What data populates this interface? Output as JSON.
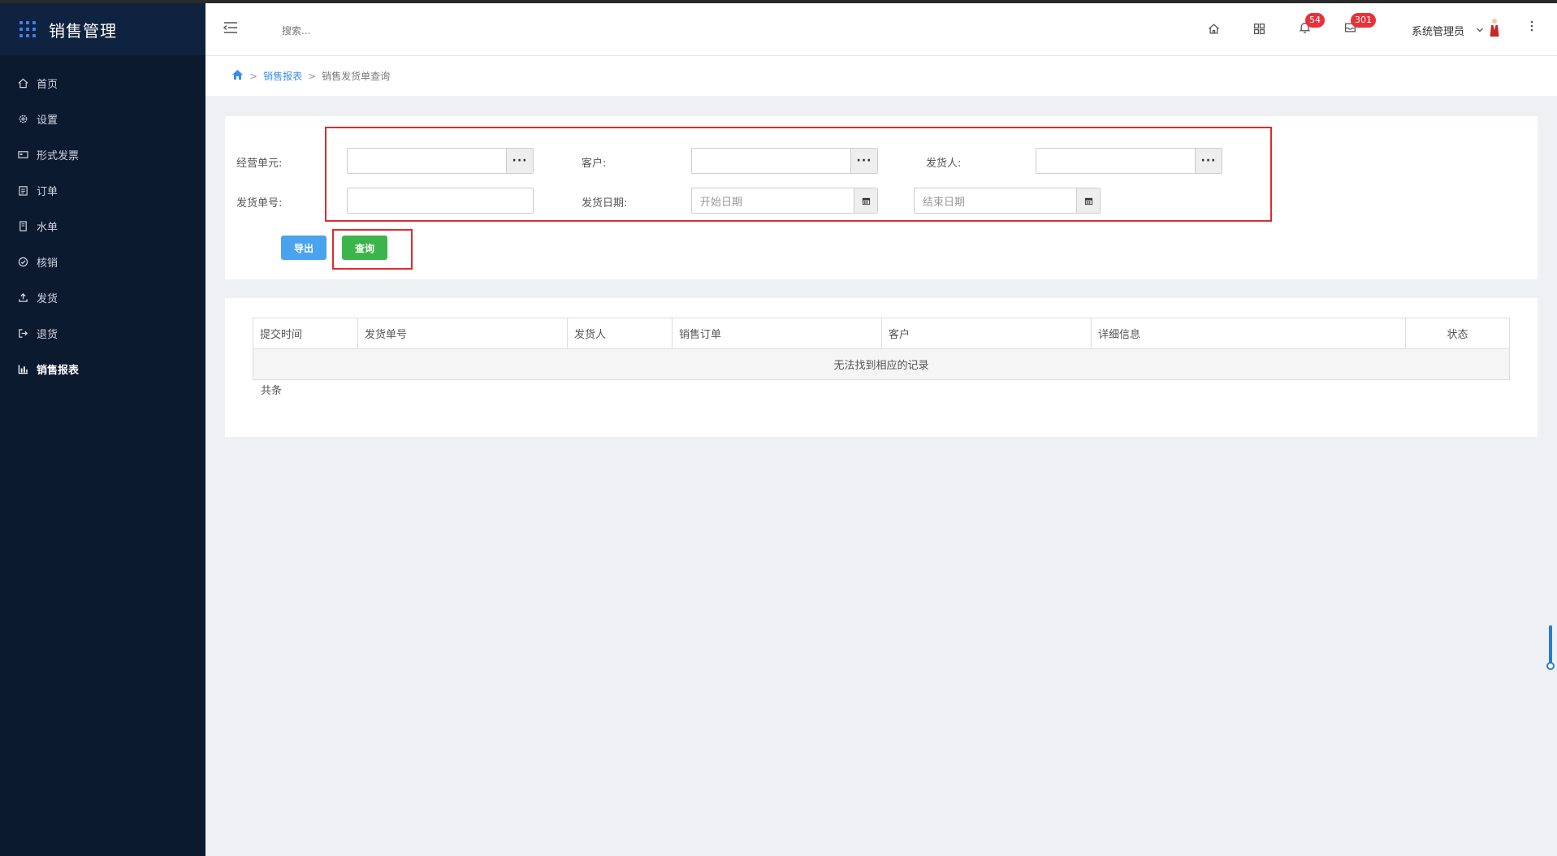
{
  "app": {
    "title": "销售管理"
  },
  "sidebar": {
    "items": [
      {
        "label": "首页",
        "icon": "home-icon"
      },
      {
        "label": "设置",
        "icon": "gear-icon"
      },
      {
        "label": "形式发票",
        "icon": "invoice-icon"
      },
      {
        "label": "订单",
        "icon": "clipboard-icon"
      },
      {
        "label": "水单",
        "icon": "receipt-icon"
      },
      {
        "label": "核销",
        "icon": "check-circle-icon"
      },
      {
        "label": "发货",
        "icon": "upload-icon"
      },
      {
        "label": "退货",
        "icon": "sign-out-icon"
      },
      {
        "label": "销售报表",
        "icon": "bar-chart-icon",
        "active": true
      }
    ]
  },
  "header": {
    "search_placeholder": "搜索...",
    "notifications_count": "54",
    "messages_count": "301",
    "user_name": "系统管理员"
  },
  "breadcrumb": {
    "parent": "销售报表",
    "current": "销售发货单查询",
    "sep": ">"
  },
  "form": {
    "business_unit_label": "经营单元:",
    "customer_label": "客户:",
    "shipper_label": "发货人:",
    "delivery_no_label": "发货单号:",
    "delivery_date_label": "发货日期:",
    "start_date_placeholder": "开始日期",
    "end_date_placeholder": "结束日期",
    "picker_label": "···"
  },
  "buttons": {
    "export": "导出",
    "query": "查询"
  },
  "table": {
    "columns": [
      "提交时间",
      "发货单号",
      "发货人",
      "销售订单",
      "客户",
      "详细信息",
      "状态"
    ],
    "empty_text": "无法找到相应的记录",
    "total_text": "共条"
  },
  "colors": {
    "sidebar_bg": "#0c1a30",
    "accent": "#3a8ee6",
    "query_btn": "#3bb54a",
    "export_btn": "#4aa3ef",
    "badge": "#e8313a",
    "highlight_box": "#e02b2b"
  }
}
